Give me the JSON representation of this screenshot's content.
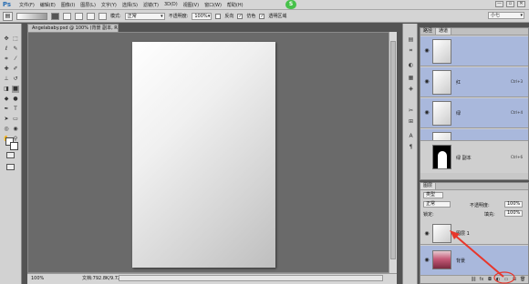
{
  "app": {
    "logo": "Ps"
  },
  "menubar": {
    "items": [
      "文件(F)",
      "编辑(E)",
      "图像(I)",
      "图层(L)",
      "文字(Y)",
      "选择(S)",
      "滤镜(T)",
      "3D(D)",
      "视图(V)",
      "窗口(W)",
      "帮助(H)"
    ],
    "window_controls": [
      "—",
      "▫",
      "✕"
    ],
    "badge": "S"
  },
  "options_bar": {
    "mode_label": "模式:",
    "mode_value": "正常",
    "opacity_label": "不透明度:",
    "opacity_value": "100%",
    "reverse_label": "反向",
    "dither_label": "仿色",
    "transparency_label": "透明区域",
    "workspace_value": "小七"
  },
  "document": {
    "tab_title": "Angelababy.psd @ 100% (背景 副本, RGB/8#)",
    "zoom": "100%",
    "doc_info": "文档:792.8K/9.72M"
  },
  "channels_panel": {
    "tabs": [
      "路径",
      "通道"
    ],
    "rows": [
      {
        "name": "",
        "key": "",
        "selected": true
      },
      {
        "name": "红",
        "key": "Ctrl+3",
        "selected": true
      },
      {
        "name": "绿",
        "key": "Ctrl+4",
        "selected": true
      },
      {
        "name": "蓝",
        "key": "Ctrl+5",
        "selected": true
      },
      {
        "name": "绿 副本",
        "key": "Ctrl+6",
        "selected": false
      }
    ]
  },
  "layers_panel": {
    "tabs": [
      "图层"
    ],
    "filter_kind": "类型",
    "blend_mode": "正常",
    "opacity_label": "不透明度:",
    "opacity_value": "100%",
    "lock_label": "锁定:",
    "fill_label": "填充:",
    "fill_value": "100%",
    "layers": [
      {
        "name": "图层 1",
        "selected": false
      },
      {
        "name": "背景",
        "selected": true
      }
    ]
  },
  "colors": {
    "selected_row": "#a9b8dc",
    "annotation_arrow": "#e8362b"
  }
}
